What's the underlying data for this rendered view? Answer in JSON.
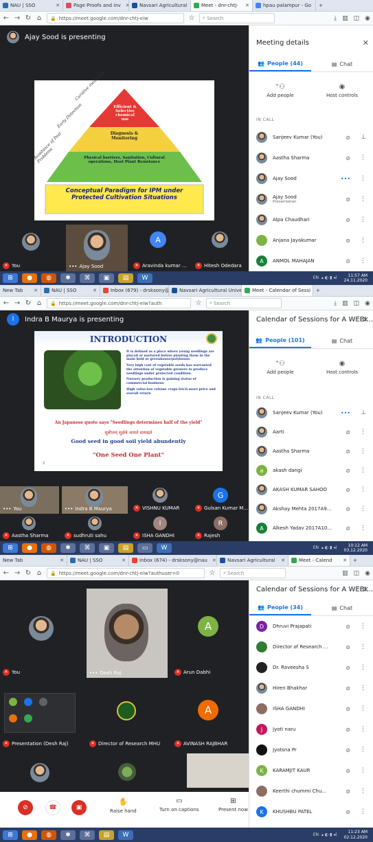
{
  "colors": {
    "meet_bg": "#202124",
    "tile_bg": "#3c4043",
    "accent": "#1a73e8",
    "muted_red": "#d93025",
    "taskbar": "#2a3d66"
  },
  "frame1": {
    "tabs": [
      {
        "label": "NAU | SSO",
        "favicon": "#2b6cb0"
      },
      {
        "label": "Page Proofs and inv",
        "favicon": "#e14b5a"
      },
      {
        "label": "Navsari Agricultural",
        "favicon": "#1a4f9c"
      },
      {
        "label": "Meet - dnr-chtj-",
        "favicon": "#34a853"
      },
      {
        "label": "hpau palampur - Go",
        "favicon": "#4285f4"
      }
    ],
    "url": "https://meet.google.com/dnr-chtj-eiw",
    "search_placeholder": "Search",
    "presenting": "Ajay Sood is presenting",
    "slide": {
      "level1": "Efficient & Selective chemical use",
      "level2": "Diagnosis & Monitoring",
      "level3": "Physical barriers, Sanitation, Cultural operations, Host Plant Resistance",
      "side1": "Curative measures",
      "side2": "Early Detection",
      "side3": "Avoidance of Pest Problems",
      "caption": "Conceptual Paradigm for IPM under Protected Cultivation Situations"
    },
    "tiles": [
      {
        "name": "You"
      },
      {
        "name": "Ajay Sood"
      },
      {
        "name": "Aravinda kumar ...",
        "initial": "A"
      },
      {
        "name": "Hitesh Odedara"
      }
    ],
    "panel": {
      "title": "Meeting details",
      "people_tab": "People (44)",
      "chat_tab": "Chat",
      "add": "Add people",
      "host": "Host controls",
      "in_call": "IN CALL",
      "people": [
        {
          "name": "Sanjeev Kumar (You)",
          "sub": ""
        },
        {
          "name": "Aastha Sharma",
          "sub": ""
        },
        {
          "name": "Ajay Sood",
          "sub": ""
        },
        {
          "name": "Ajay Sood",
          "sub": "Presentation"
        },
        {
          "name": "Alpa Chaudhari",
          "sub": ""
        },
        {
          "name": "Anjana Jayakumar",
          "sub": ""
        },
        {
          "name": "ANMOL MAHAJAN",
          "sub": "",
          "initial": "A"
        }
      ]
    },
    "clock": {
      "time": "11:57 AM",
      "date": "24.11.2020"
    },
    "lang": "EN"
  },
  "frame2": {
    "tabs": [
      {
        "label": "New Tab",
        "favicon": "#888888"
      },
      {
        "label": "NAU | SSO",
        "favicon": "#2b6cb0"
      },
      {
        "label": "Inbox (679) - drsksony@",
        "favicon": "#ea4335"
      },
      {
        "label": "Navsari Agricultural Univers",
        "favicon": "#1a4f9c"
      },
      {
        "label": "Meet - Calendar of Sessi",
        "favicon": "#34a853"
      }
    ],
    "url": "https://meet.google.com/dnr-chtj-eiw?auth",
    "search_placeholder": "Search",
    "presenting": "Indra B Maurya is presenting",
    "presenter_initial": "I",
    "slide": {
      "title": "INTRODUCTION",
      "bullets": [
        "It is defined as a place where young seedlings are placed or nurtured before planting them in the main field or greenhouse/polyhouse.",
        "Very high cost of vegetable seeds has warranted the attention of vegetable growers to produce seedlings under protected condition.",
        "Nursery production is gaining status of commercial business.",
        "High value-low volume crops fetch more price and overall return"
      ],
      "quote": "An Japanese quote says \"Seedlings determines half of the yield\"",
      "hindi": "सुबीजम् सुक्षेत्रे जायते सम्पद्यते",
      "good_seed": "Good seed in good soil yield abundently",
      "one_seed": "\"One Seed One Plant\"",
      "page": "2"
    },
    "tiles": [
      {
        "name": "You"
      },
      {
        "name": "Indra B Maurya"
      },
      {
        "name": "VISHNU KUMAR"
      },
      {
        "name": "Gulsan Kumar M...",
        "initial": "G"
      },
      {
        "name": "Aastha Sharma"
      },
      {
        "name": "sudhruti sahu"
      },
      {
        "name": "ISHA GANDHI",
        "initial": "I"
      },
      {
        "name": "Rajesh",
        "initial": "R"
      }
    ],
    "panel": {
      "title": "Calendar of Sessions for A WEBI...",
      "people_tab": "People (101)",
      "chat_tab": "Chat",
      "add": "Add people",
      "host": "Host controls",
      "in_call": "IN CALL",
      "people": [
        {
          "name": "Sanjeev Kumar (You)"
        },
        {
          "name": "Aarti"
        },
        {
          "name": "Aastha Sharma"
        },
        {
          "name": "akash dangi",
          "initial": "a"
        },
        {
          "name": "AKASH KUMAR SAHOO"
        },
        {
          "name": "Akshay Mehta 2017A9..."
        },
        {
          "name": "Alkesh Yadav 2017A10...",
          "initial": "A"
        }
      ]
    },
    "clock": {
      "time": "10:12 AM",
      "date": "03.12.2020"
    },
    "lang": "EN"
  },
  "frame3": {
    "tabs": [
      {
        "label": "New Tab",
        "favicon": "#888888"
      },
      {
        "label": "NAU | SSO",
        "favicon": "#2b6cb0"
      },
      {
        "label": "Inbox (674) - drsksony@nau",
        "favicon": "#ea4335"
      },
      {
        "label": "Navsari Agricultural",
        "favicon": "#1a4f9c"
      },
      {
        "label": "Meet - Calend",
        "favicon": "#34a853"
      }
    ],
    "url": "https://meet.google.com/dnr-chtj-eiw?authuser=0",
    "search_placeholder": "Search",
    "tiles": [
      {
        "name": "You"
      },
      {
        "name": "Desh Raj"
      },
      {
        "name": "Arun Dabhi",
        "initial": "A"
      },
      {
        "name": "Presentation (Desh Raj)"
      },
      {
        "name": "Director of Research MHU"
      },
      {
        "name": "AVINASH RAJBHAR",
        "initial": "A"
      }
    ],
    "panel": {
      "title": "Calendar of Sessions for A WEBI...",
      "people_tab": "People (34)",
      "chat_tab": "Chat",
      "people": [
        {
          "name": "Dhruvi Prajapati",
          "initial": "D"
        },
        {
          "name": "Director of Research ..."
        },
        {
          "name": "Dr. Raveesha S"
        },
        {
          "name": "Hiren Bhakhar"
        },
        {
          "name": "ISHA GANDHI"
        },
        {
          "name": "Jyoti naru",
          "initial": "J"
        },
        {
          "name": "Jyotsna Pr"
        },
        {
          "name": "KARAMJIT KAUR",
          "initial": "K"
        },
        {
          "name": "Keerthi chummi Chu..."
        },
        {
          "name": "KHUSHBU PATEL",
          "initial": "K"
        }
      ]
    },
    "controls": {
      "raise": "Raise hand",
      "captions": "Turn on captions",
      "present": "Present now"
    },
    "clock": {
      "time": "11:23 AM",
      "date": "02.12.2020"
    },
    "lang": "EN"
  }
}
